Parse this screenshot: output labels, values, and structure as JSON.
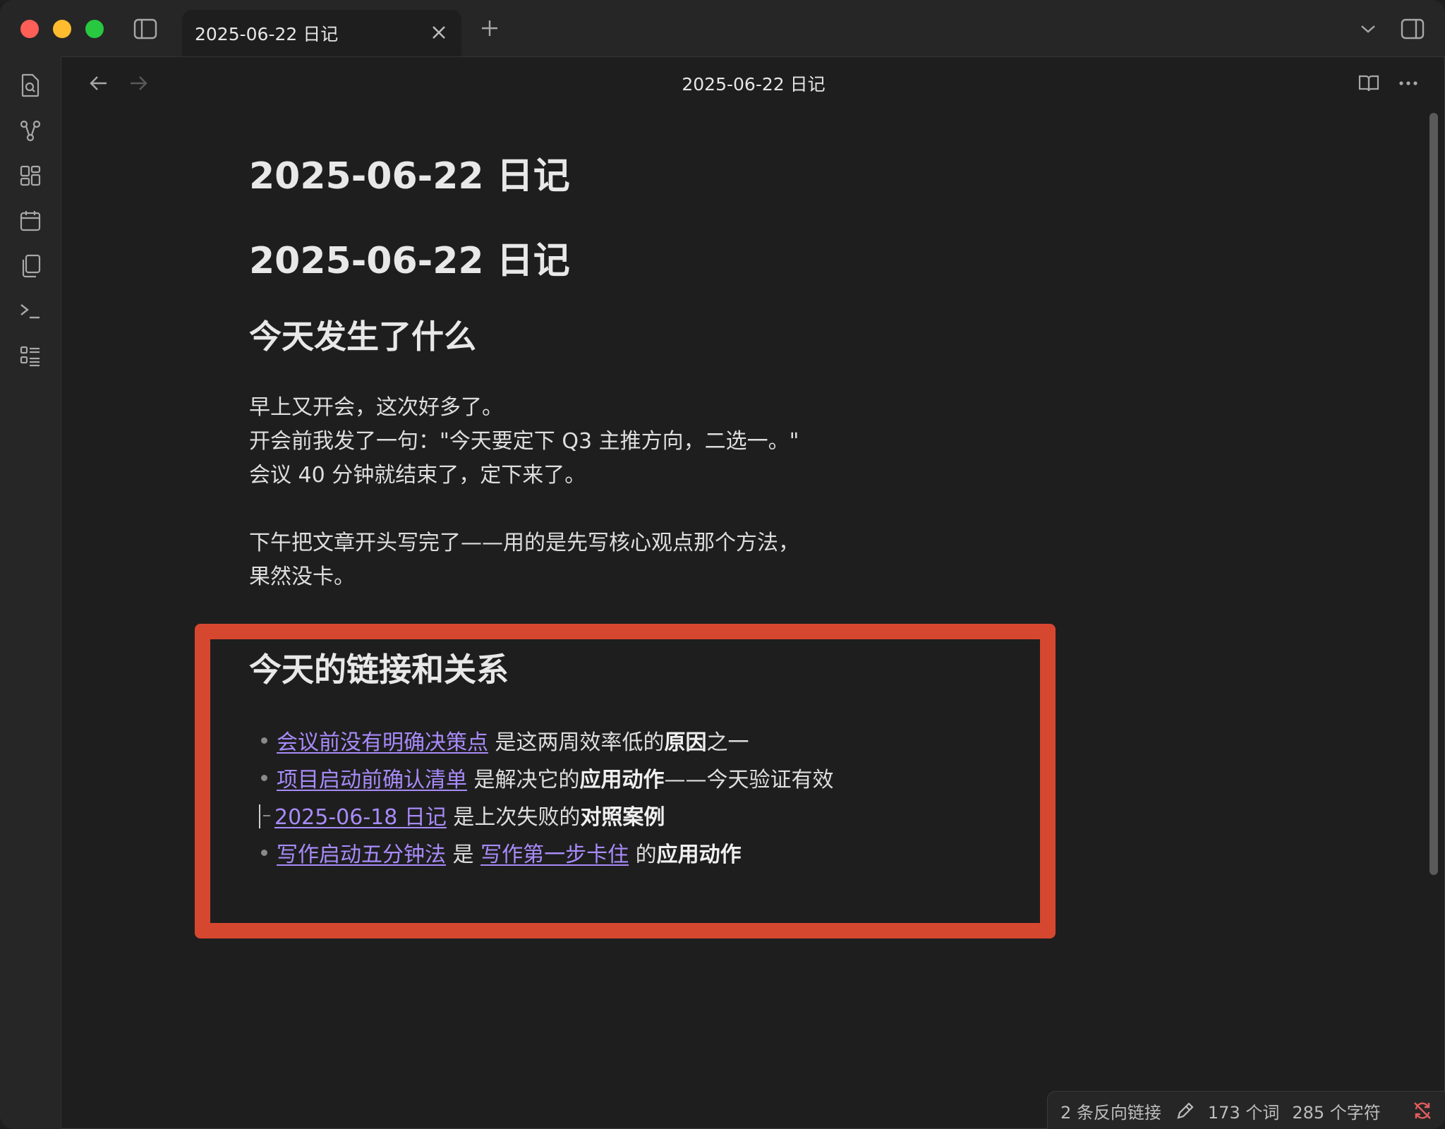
{
  "window": {
    "tab_title": "2025-06-22 日记",
    "doc_title": "2025-06-22 日记"
  },
  "note": {
    "title": "2025-06-22 日记",
    "heading1": "2025-06-22 日记",
    "section1_heading": "今天发生了什么",
    "para1": [
      "早上又开会，这次好多了。",
      "开会前我发了一句：\"今天要定下 Q3 主推方向，二选一。\"",
      "会议 40 分钟就结束了，定下来了。"
    ],
    "para2": [
      "下午把文章开头写完了——用的是先写核心观点那个方法，",
      "果然没卡。"
    ],
    "section2_heading": "今天的链接和关系",
    "links": [
      {
        "link": "会议前没有明确决策点",
        "text1": " 是这两周效率低的",
        "bold1": "原因",
        "text2": "之一"
      },
      {
        "link": "项目启动前确认清单",
        "text1": " 是解决它的",
        "bold1": "应用动作",
        "text2": "——今天验证有效"
      },
      {
        "link": "2025-06-18 日记",
        "text1": " 是上次失败的",
        "bold1": "对照案例",
        "text2": ""
      },
      {
        "link": "写作启动五分钟法",
        "mid": " 是 ",
        "link2": "写作第一步卡住",
        "text1": " 的",
        "bold1": "应用动作"
      }
    ]
  },
  "status_bar": {
    "backlinks": "2 条反向链接",
    "words": "173 个词",
    "chars": "285 个字符"
  },
  "colors": {
    "link": "#a88bfa",
    "highlight_border": "#d6472f",
    "background": "#1e1e1e"
  }
}
